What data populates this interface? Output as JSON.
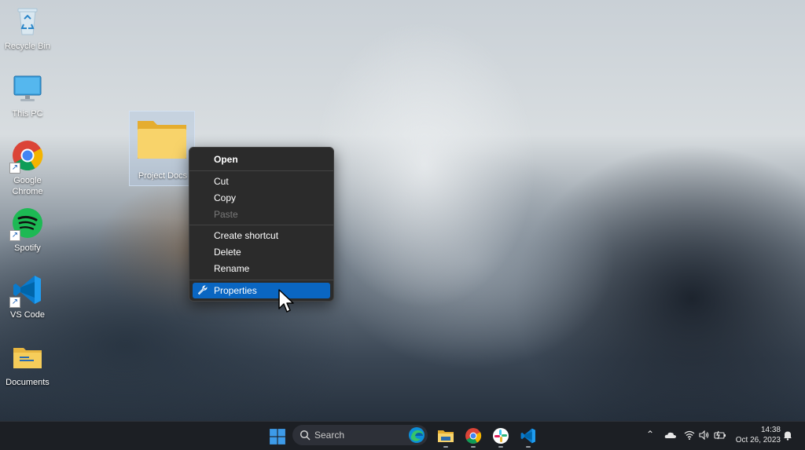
{
  "desktop": {
    "icons": [
      {
        "label": "Recycle Bin"
      },
      {
        "label": "This PC"
      },
      {
        "label": "Google Chrome"
      },
      {
        "label": "Spotify"
      },
      {
        "label": "VS Code"
      },
      {
        "label": "Documents"
      }
    ],
    "selected_folder": {
      "label": "Project Docs"
    }
  },
  "context_menu": {
    "open": "Open",
    "cut": "Cut",
    "copy": "Copy",
    "paste": "Paste",
    "create_shortcut": "Create shortcut",
    "delete": "Delete",
    "rename": "Rename",
    "properties": "Properties"
  },
  "taskbar": {
    "search_placeholder": "Search",
    "time": "14:38",
    "date": "Oct 26, 2023"
  },
  "colors": {
    "menu_highlight": "#0a66c2",
    "taskbar_bg": "#1c1f24",
    "menu_bg": "#2b2b2b"
  }
}
